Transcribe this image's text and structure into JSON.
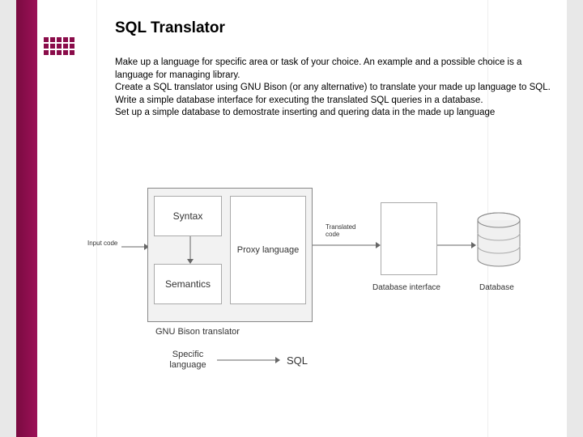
{
  "title": "SQL Translator",
  "body": {
    "p1": "Make up a language for specific area or task of your choice. An example and a possible choice is a language for managing library.",
    "p2": "Create a SQL translator using GNU Bison (or any alternative) to translate your made up language to SQL.",
    "p3": "Write a simple database interface  for executing the translated SQL queries in a database.",
    "p4": "Set up a simple database to demostrate inserting and quering data in the made up language"
  },
  "diagram": {
    "input_code": "Input code",
    "syntax": "Syntax",
    "semantics": "Semantics",
    "proxy": "Proxy language",
    "gnu": "GNU Bison translator",
    "translated": "Translated code",
    "db_interface": "Database interface",
    "database": "Database",
    "specific_language": "Specific language",
    "sql": "SQL"
  }
}
